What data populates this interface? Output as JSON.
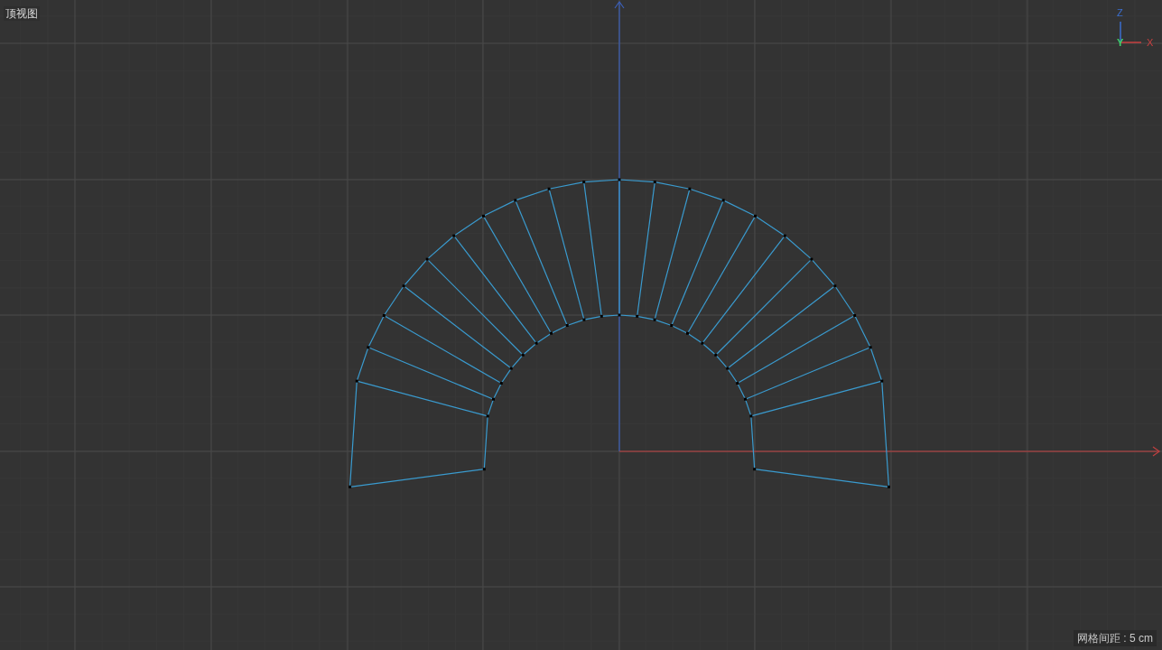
{
  "viewport": {
    "title": "顶视图",
    "grid_spacing": "网格间距 : 5 cm"
  },
  "axis_gizmo": {
    "z": "Z",
    "y": "Y",
    "x": "X"
  }
}
